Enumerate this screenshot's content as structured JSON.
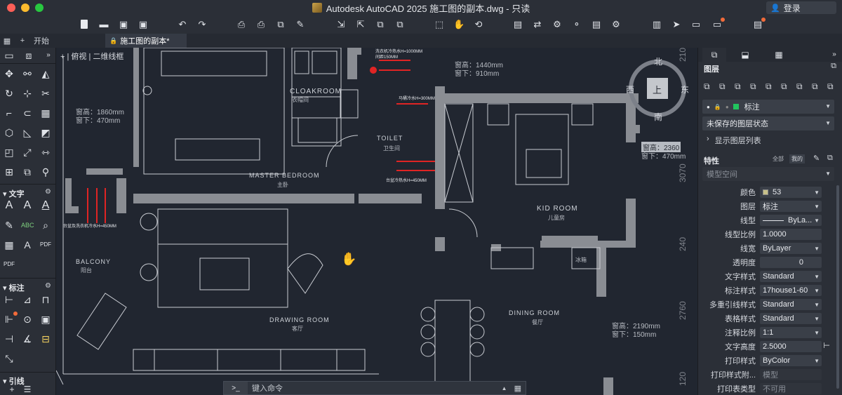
{
  "window": {
    "title": "Autodesk AutoCAD 2025   施工图的副本.dwg - 只读",
    "login": "登录"
  },
  "tabs": [
    {
      "label": "开始"
    },
    {
      "label": "施工图的副本*"
    }
  ],
  "viewport": {
    "label": "+ | 俯视 | 二维线框"
  },
  "left_palette": {
    "sections": [
      {
        "label": "文字"
      },
      {
        "label": "标注"
      },
      {
        "label": "引线"
      }
    ],
    "pdf_label": "PDF"
  },
  "drawing": {
    "rooms": [
      {
        "en": "CLOAKROOM",
        "cn": "衣帽间"
      },
      {
        "en": "TOILET",
        "cn": "卫生间"
      },
      {
        "en": "MASTER BEDROOM",
        "cn": "主卧"
      },
      {
        "en": "KID ROOM",
        "cn": "儿童房"
      },
      {
        "en": "BALCONY",
        "cn": "阳台"
      },
      {
        "en": "DRAWING ROOM",
        "cn": "客厅"
      },
      {
        "en": "DINING ROOM",
        "cn": "餐厅"
      }
    ],
    "window_notes": [
      {
        "h": "窗高：1860mm",
        "b": "窗下：470mm"
      },
      {
        "h": "窗高：1440mm",
        "b": "窗下：910mm"
      },
      {
        "h": "窗高：2190mm",
        "b": "窗下：150mm"
      }
    ],
    "kid_note": {
      "h": "窗高：2360",
      "b": "窗下：470mm"
    },
    "dimensions": [
      "210",
      "3070",
      "240",
      "2760",
      "120"
    ],
    "fridge_label": "冰箱",
    "annotations": [
      "洗衣机冷热水H=1000MM",
      "间距150MM",
      "马桶冷水H=300MM",
      "台盆冷热水H=450MM",
      "台盆及洗衣机冷水H=450MM"
    ]
  },
  "compass": {
    "north": "北",
    "south": "南",
    "east": "东",
    "west": "西",
    "center": "上"
  },
  "command": {
    "prompt": ">_",
    "placeholder": "键入命令"
  },
  "right_panel": {
    "layers_title": "图层",
    "current_layer": "标注",
    "layer_state": "未保存的图层状态",
    "show_list": "显示图层列表",
    "properties_title": "特性",
    "filter_all": "全部",
    "filter_mine": "我的",
    "space": "模型空间",
    "properties": [
      {
        "label": "颜色",
        "value": "53"
      },
      {
        "label": "图层",
        "value": "标注"
      },
      {
        "label": "线型",
        "value": "ByLa..."
      },
      {
        "label": "线型比例",
        "value": "1.0000"
      },
      {
        "label": "线宽",
        "value": "ByLayer"
      },
      {
        "label": "透明度",
        "value": "0"
      },
      {
        "label": "文字样式",
        "value": "Standard"
      },
      {
        "label": "标注样式",
        "value": "17house1-60"
      },
      {
        "label": "多重引线样式",
        "value": "Standard"
      },
      {
        "label": "表格样式",
        "value": "Standard"
      },
      {
        "label": "注释比例",
        "value": "1:1"
      },
      {
        "label": "文字高度",
        "value": "2.5000"
      },
      {
        "label": "打印样式",
        "value": "ByColor"
      },
      {
        "label": "打印样式附...",
        "value": "模型"
      },
      {
        "label": "打印表类型",
        "value": "不可用"
      }
    ],
    "colors": {
      "swatch": "#c7c089",
      "layer_green": "#22c55e"
    }
  }
}
